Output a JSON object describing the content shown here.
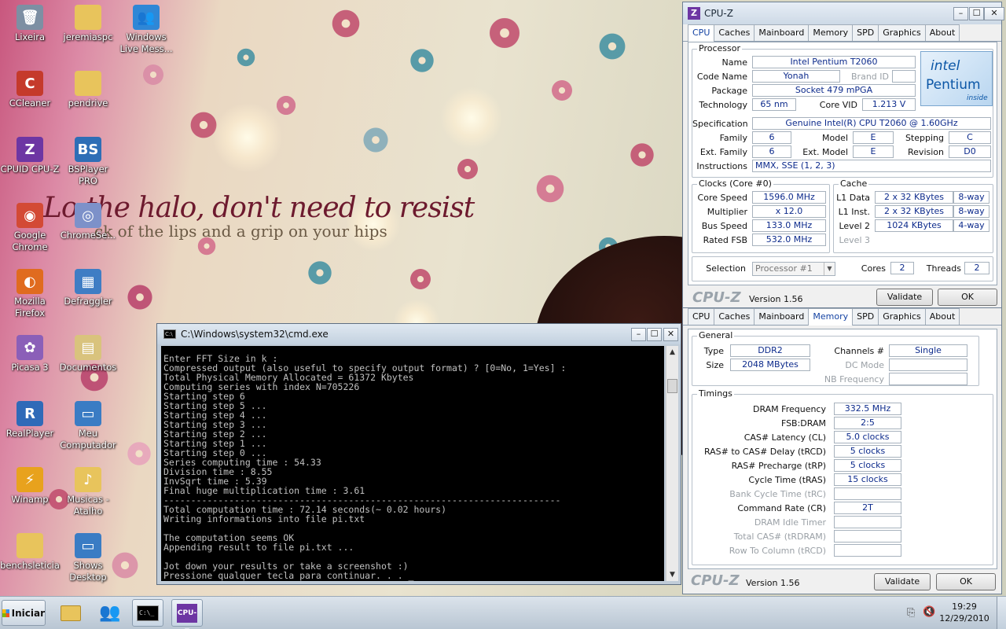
{
  "desktop": {
    "lyric_line1": "Lo    the halo, don't need to resist",
    "lyric_line2": "ck of the lips and a grip on your hips",
    "icons": [
      {
        "label": "Lixeira",
        "icon": "recycle-bin-icon",
        "glyph": "🗑",
        "color": "#7d8fa3"
      },
      {
        "label": "jeremiaspc",
        "icon": "folder-icon",
        "glyph": "",
        "color": "#e8c45c"
      },
      {
        "label": "Windows Live Mess...",
        "icon": "messenger-icon",
        "glyph": "👥",
        "color": "#2f87d6"
      },
      {
        "label": "CCleaner",
        "icon": "ccleaner-icon",
        "glyph": "C",
        "color": "#c53a2b"
      },
      {
        "label": "pendrive",
        "icon": "folder-icon",
        "glyph": "",
        "color": "#e8c45c"
      },
      {
        "label": "CPUID CPU-Z",
        "icon": "cpuz-icon",
        "glyph": "Z",
        "color": "#6d36a3"
      },
      {
        "label": "BSPlayer PRO",
        "icon": "bsplayer-icon",
        "glyph": "BS",
        "color": "#2e6eb6"
      },
      {
        "label": "Google Chrome",
        "icon": "chrome-icon",
        "glyph": "◉",
        "color": "#d34a35"
      },
      {
        "label": "ChromeSe...",
        "icon": "disc-icon",
        "glyph": "◎",
        "color": "#7d91c9"
      },
      {
        "label": "Mozilla Firefox",
        "icon": "firefox-icon",
        "glyph": "◐",
        "color": "#e06b1f"
      },
      {
        "label": "Defraggler",
        "icon": "defraggler-icon",
        "glyph": "▦",
        "color": "#3f7dc4"
      },
      {
        "label": "Picasa 3",
        "icon": "picasa-icon",
        "glyph": "✿",
        "color": "#8b5fb8"
      },
      {
        "label": "Documentos",
        "icon": "documents-icon",
        "glyph": "▤",
        "color": "#d9c37d"
      },
      {
        "label": "RealPlayer",
        "icon": "realplayer-icon",
        "glyph": "R",
        "color": "#2f6ab8"
      },
      {
        "label": "Meu Computador",
        "icon": "computer-icon",
        "glyph": "▭",
        "color": "#3a7cc4"
      },
      {
        "label": "Winamp",
        "icon": "winamp-icon",
        "glyph": "⚡",
        "color": "#e8a21d"
      },
      {
        "label": "Musicas - Atalho",
        "icon": "music-folder-icon",
        "glyph": "♪",
        "color": "#e8c45c"
      },
      {
        "label": "benchsleticia",
        "icon": "folder-icon",
        "glyph": "",
        "color": "#e8c45c"
      },
      {
        "label": "Shows Desktop",
        "icon": "show-desktop-icon",
        "glyph": "▭",
        "color": "#3a7cc4"
      }
    ]
  },
  "cpuz1": {
    "title": "CPU-Z",
    "tabs": [
      "CPU",
      "Caches",
      "Mainboard",
      "Memory",
      "SPD",
      "Graphics",
      "About"
    ],
    "active_tab": "CPU",
    "processor_group": "Processor",
    "name_label": "Name",
    "name": "Intel Pentium T2060",
    "codename_label": "Code Name",
    "codename": "Yonah",
    "brandid_label": "Brand ID",
    "package_label": "Package",
    "package": "Socket 479 mPGA",
    "technology_label": "Technology",
    "technology": "65 nm",
    "corevid_label": "Core VID",
    "corevid": "1.213 V",
    "spec_label": "Specification",
    "spec": "Genuine Intel(R) CPU          T2060  @ 1.60GHz",
    "family_label": "Family",
    "family": "6",
    "model_label": "Model",
    "model": "E",
    "stepping_label": "Stepping",
    "stepping": "C",
    "extfamily_label": "Ext. Family",
    "extfamily": "6",
    "extmodel_label": "Ext. Model",
    "extmodel": "E",
    "revision_label": "Revision",
    "revision": "D0",
    "instructions_label": "Instructions",
    "instructions": "MMX, SSE (1, 2, 3)",
    "logo_brand": "intel",
    "logo_product": "Pentium",
    "logo_inside": "inside",
    "clocks_group": "Clocks (Core #0)",
    "corespeed_label": "Core Speed",
    "corespeed": "1596.0 MHz",
    "multiplier_label": "Multiplier",
    "multiplier": "x 12.0",
    "busspeed_label": "Bus Speed",
    "busspeed": "133.0 MHz",
    "ratedfsb_label": "Rated FSB",
    "ratedfsb": "532.0 MHz",
    "cache_group": "Cache",
    "l1data_label": "L1 Data",
    "l1data": "2 x 32 KBytes",
    "l1data_way": "8-way",
    "l1inst_label": "L1 Inst.",
    "l1inst": "2 x 32 KBytes",
    "l1inst_way": "8-way",
    "level2_label": "Level 2",
    "level2": "1024 KBytes",
    "level2_way": "4-way",
    "level3_label": "Level 3",
    "selection_label": "Selection",
    "selection": "Processor #1",
    "cores_label": "Cores",
    "cores": "2",
    "threads_label": "Threads",
    "threads": "2",
    "footer_logo": "CPU-Z",
    "version": "Version 1.56",
    "validate": "Validate",
    "ok": "OK"
  },
  "cpuz2": {
    "tabs": [
      "CPU",
      "Caches",
      "Mainboard",
      "Memory",
      "SPD",
      "Graphics",
      "About"
    ],
    "active_tab": "Memory",
    "general_group": "General",
    "type_label": "Type",
    "type": "DDR2",
    "size_label": "Size",
    "size": "2048 MBytes",
    "channels_label": "Channels #",
    "channels": "Single",
    "dcmode_label": "DC Mode",
    "nbfreq_label": "NB Frequency",
    "timings_group": "Timings",
    "timings": [
      {
        "label": "DRAM Frequency",
        "value": "332.5 MHz",
        "dim": false
      },
      {
        "label": "FSB:DRAM",
        "value": "2:5",
        "dim": false
      },
      {
        "label": "CAS# Latency (CL)",
        "value": "5.0 clocks",
        "dim": false
      },
      {
        "label": "RAS# to CAS# Delay (tRCD)",
        "value": "5 clocks",
        "dim": false
      },
      {
        "label": "RAS# Precharge (tRP)",
        "value": "5 clocks",
        "dim": false
      },
      {
        "label": "Cycle Time (tRAS)",
        "value": "15 clocks",
        "dim": false
      },
      {
        "label": "Bank Cycle Time (tRC)",
        "value": "",
        "dim": true
      },
      {
        "label": "Command Rate (CR)",
        "value": "2T",
        "dim": false
      },
      {
        "label": "DRAM Idle Timer",
        "value": "",
        "dim": true
      },
      {
        "label": "Total CAS# (tRDRAM)",
        "value": "",
        "dim": true
      },
      {
        "label": "Row To Column (tRCD)",
        "value": "",
        "dim": true
      }
    ],
    "footer_logo": "CPU-Z",
    "version": "Version 1.56",
    "validate": "Validate",
    "ok": "OK"
  },
  "cmd": {
    "title": "C:\\Windows\\system32\\cmd.exe",
    "lines": [
      "Enter FFT Size in k :",
      "Compressed output (also useful to specify output format) ? [0=No, 1=Yes] :",
      "Total Physical Memory Allocated = 61372 Kbytes",
      "Computing series with index N=705226",
      "Starting step 6",
      "Starting step 5 ...",
      "Starting step 4 ...",
      "Starting step 3 ...",
      "Starting step 2 ...",
      "Starting step 1 ...",
      "Starting step 0 ...",
      "Series computing time : 54.33",
      "Division time : 8.55",
      "InvSqrt time : 5.39",
      "Final huge multiplication time : 3.61",
      "-------------------------------------------------------------------------",
      "Total computation time : 72.14 seconds(~ 0.02 hours)",
      "Writing informations into file pi.txt",
      "",
      "The computation seems OK",
      "Appending result to file pi.txt ...",
      "",
      "Jot down your results or take a screenshot :)",
      "Pressione qualquer tecla para continuar. . . _"
    ]
  },
  "taskbar": {
    "start_label": "Iniciar",
    "clock_time": "19:29",
    "clock_date": "12/29/2010"
  }
}
